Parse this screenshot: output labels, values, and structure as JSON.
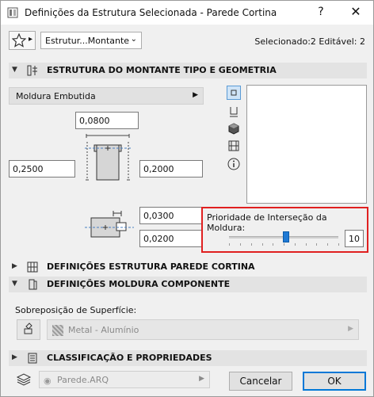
{
  "window": {
    "title": "Definições da Estrutura Selecionada - Parede Cortina",
    "help_label": "?",
    "close_label": "✕"
  },
  "toolbar": {
    "favorites_arrow": "▸",
    "selector_value": "Estrutur...Montante",
    "selector_chevron": "⌄",
    "selection_info": "Selecionado:2 Editável: 2"
  },
  "sections": {
    "mullion": {
      "toggle": "▼",
      "title": "ESTRUTURA DO MONTANTE TIPO E GEOMETRIA"
    },
    "curtain_wall": {
      "toggle": "▶",
      "title": "DEFINIÇÕES ESTRUTURA PAREDE CORTINA"
    },
    "component": {
      "toggle": "▼",
      "title": "DEFINIÇÕES MOLDURA COMPONENTE"
    },
    "classification": {
      "toggle": "▶",
      "title": "CLASSIFICAÇÃO E PROPRIEDADES"
    }
  },
  "mullion": {
    "type_label": "Moldura Embutida",
    "type_arrow": "▶",
    "top_width": "0,0800",
    "left_depth": "0,2500",
    "right_depth": "0,2000",
    "offset_a": "0,0300",
    "offset_b": "0,0200"
  },
  "priority": {
    "label": "Prioridade de Interseção da Moldura:",
    "value": "10",
    "level_fraction": 0.5
  },
  "surface": {
    "label": "Sobreposição de Superfície:",
    "material": "Metal - Alumínio",
    "arrow": "▶"
  },
  "footer": {
    "layer": "Parede.ARQ",
    "layer_arrow": "▶",
    "cancel_label": "Cancelar",
    "ok_label": "OK"
  },
  "colors": {
    "highlight_border": "#e02020",
    "slider_thumb": "#1f79d4",
    "ok_border": "#0078d7"
  }
}
